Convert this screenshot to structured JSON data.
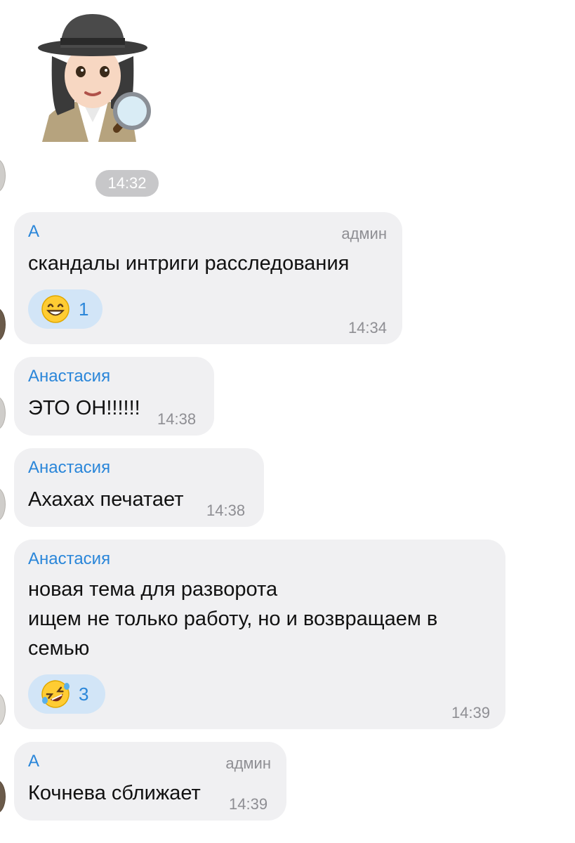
{
  "sticker": {
    "icon": "detective-woman-sticker"
  },
  "time_pill": "14:32",
  "messages": [
    {
      "sender": "А",
      "role": "админ",
      "lines": [
        "скандалы интриги расследования"
      ],
      "reaction": {
        "icon": "grinning-face-icon",
        "count": "1"
      },
      "time": "14:34"
    },
    {
      "sender": "Анастасия",
      "lines": [
        "ЭТО ОН!!!!!!"
      ],
      "time": "14:38"
    },
    {
      "sender": "Анастасия",
      "lines": [
        "Ахахах печатает"
      ],
      "time": "14:38"
    },
    {
      "sender": "Анастасия",
      "lines": [
        "новая тема для разворота",
        "ищем не только работу, но и возвращаем в",
        "семью"
      ],
      "reaction": {
        "icon": "rolling-laughing-face-icon",
        "count": "3"
      },
      "time": "14:39"
    },
    {
      "sender": "А",
      "role": "админ",
      "lines": [
        "Кочнева сближает"
      ],
      "time": "14:39"
    }
  ],
  "colors": {
    "bubble": "#f0f0f2",
    "sender": "#2a86d9",
    "reaction_bg": "#d2e5f7",
    "meta": "#8e8e93"
  }
}
